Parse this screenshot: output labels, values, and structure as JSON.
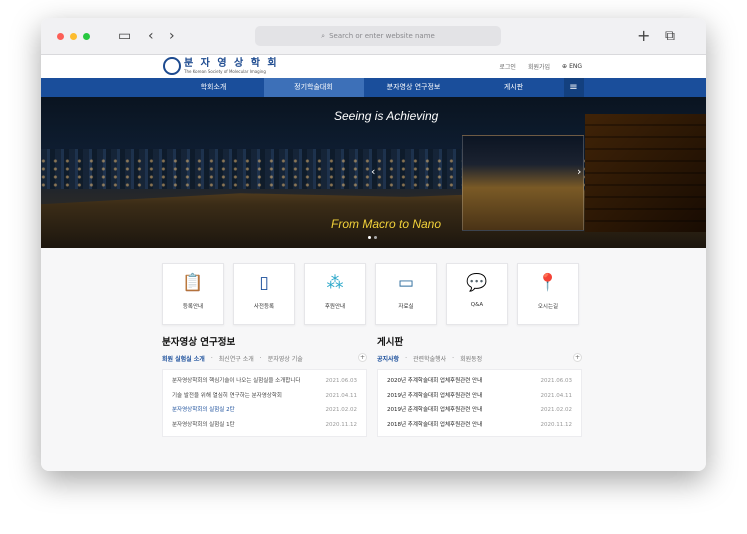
{
  "browser": {
    "address_placeholder": "Search or enter website name"
  },
  "site": {
    "logo_ko": "분 자 영 상 학 회",
    "logo_en": "The Korean Society of Molecular Imaging",
    "top_links": [
      "로그인",
      "회원가입",
      "ENG"
    ],
    "nav": [
      "학회소개",
      "정기학술대회",
      "분자영상 연구정보",
      "게시판"
    ],
    "nav_active": "정기학술대회",
    "hero": {
      "caption_top": "Seeing is Achieving",
      "caption_bottom": "From Macro to Nano"
    },
    "quick_links": [
      {
        "label": "등록안내",
        "icon": "clipboard-icon"
      },
      {
        "label": "사전등록",
        "icon": "mobile-icon"
      },
      {
        "label": "후원안내",
        "icon": "network-icon"
      },
      {
        "label": "자료실",
        "icon": "laptop-icon"
      },
      {
        "label": "Q&A",
        "icon": "chat-icon"
      },
      {
        "label": "오시는길",
        "icon": "map-pin-icon"
      }
    ],
    "research": {
      "title": "분자영상 연구정보",
      "tabs": [
        "회원 실험실 소개",
        "최신연구 소개",
        "분자영상 기술"
      ],
      "rows": [
        {
          "text": "분자영상학회의 핵심기술이 나오는 실험실을 소개합니다",
          "date": "2021.06.03"
        },
        {
          "text": "기술 발전을 위해 열심히 연구하는 분자영상학회",
          "date": "2021.04.11"
        },
        {
          "text": "분자영상학회의 실험실 2탄",
          "date": "2021.02.02"
        },
        {
          "text": "분자영상학회의 실험실 1탄",
          "date": "2020.11.12"
        }
      ]
    },
    "board": {
      "title": "게시판",
      "tabs": [
        "공지사항",
        "관련학술행사",
        "회원동정"
      ],
      "rows": [
        {
          "text": "2020년 추계학술대회 업체후원관련 안내",
          "date": "2021.06.03"
        },
        {
          "text": "2019년 추계학술대회 업체후원관련 안내",
          "date": "2021.04.11"
        },
        {
          "text": "2019년 춘계학술대회 업체후원관련 안내",
          "date": "2021.02.02"
        },
        {
          "text": "2018년 추계학술대회 업체후원관련 안내",
          "date": "2020.11.12"
        }
      ]
    }
  }
}
